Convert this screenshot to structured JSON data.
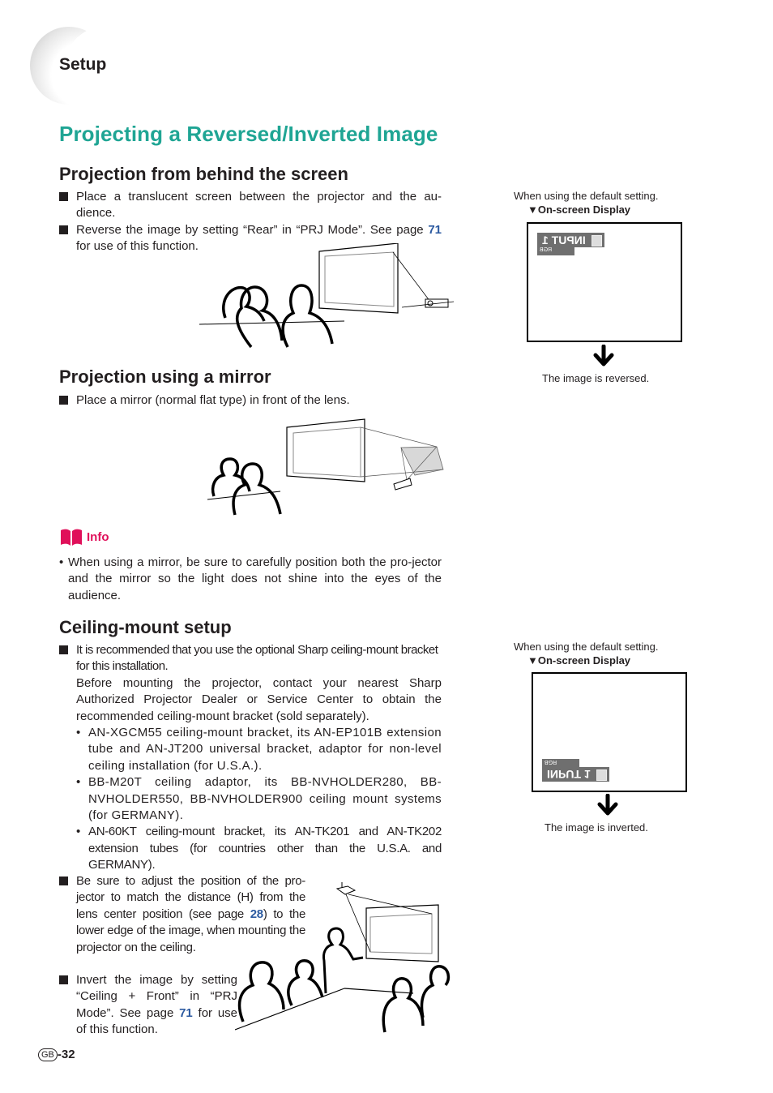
{
  "section_tag": "Setup",
  "page_title": "Projecting a Reversed/Inverted Image",
  "sections": {
    "behind": {
      "heading": "Projection from behind the screen",
      "bullets": [
        {
          "text": "Place a translucent screen between the projector and the au-dience."
        },
        {
          "pre": "Reverse the image by setting “Rear” in “PRJ Mode”. See page ",
          "link": "71",
          "post": " for use of this function."
        }
      ]
    },
    "mirror": {
      "heading": "Projection using a mirror",
      "bullets": [
        {
          "text": "Place a mirror (normal flat type) in front of the lens."
        }
      ]
    },
    "info": {
      "label": "Info",
      "icon": "book-icon",
      "text": "When using a mirror, be sure to carefully position both the pro-jector and the mirror so the light does not shine into the eyes of the audience."
    },
    "ceiling": {
      "heading": "Ceiling-mount setup",
      "bullet1_line1": "It is recommended that you use the optional Sharp ceiling-mount bracket for this installation.",
      "bullet1_line2": "Before mounting the projector, contact your nearest Sharp Authorized Projector Dealer or Service Center to obtain the recommended ceiling-mount bracket (sold separately).",
      "sub_items": [
        "AN-XGCM55 ceiling-mount bracket, its AN-EP101B extension tube and AN-JT200 universal bracket, adaptor for non-level ceiling installation (for U.S.A.).",
        "BB-M20T ceiling adaptor, its BB-NVHOLDER280, BB-NVHOLDER550, BB-NVHOLDER900 ceiling mount systems (for GERMANY).",
        "AN-60KT ceiling-mount bracket, its AN-TK201 and AN-TK202 extension tubes (for countries other than the U.S.A. and GERMANY)."
      ],
      "bullet2": {
        "pre": "Be sure to adjust the position of the pro-jector to match the distance (H) from the lens center position (see page ",
        "link": "28",
        "post": ") to the lower edge of the image, when mounting the projector on the ceiling."
      },
      "bullet3": {
        "pre": "Invert the image by setting “Ceiling + Front” in “PRJ Mode”. See page ",
        "link": "71",
        "post": " for use of this function."
      }
    }
  },
  "osd_panels": [
    {
      "caption": "When using the default setting.",
      "title": "▼On-screen Display",
      "osd_label": "INPUT 1",
      "osd_sub": "RGB",
      "state": "reversed",
      "result": "The image is reversed."
    },
    {
      "caption": "When using the default setting.",
      "title": "▼On-screen Display",
      "osd_label": "INPUT 1",
      "osd_sub": "RGB",
      "state": "inverted",
      "result": "The image is inverted."
    }
  ],
  "footer": {
    "region": "GB",
    "page": "-32"
  },
  "colors": {
    "title": "#1fa594",
    "link": "#2c5aa0",
    "info": "#e0105a",
    "osd_bar": "#6f6f6f"
  }
}
